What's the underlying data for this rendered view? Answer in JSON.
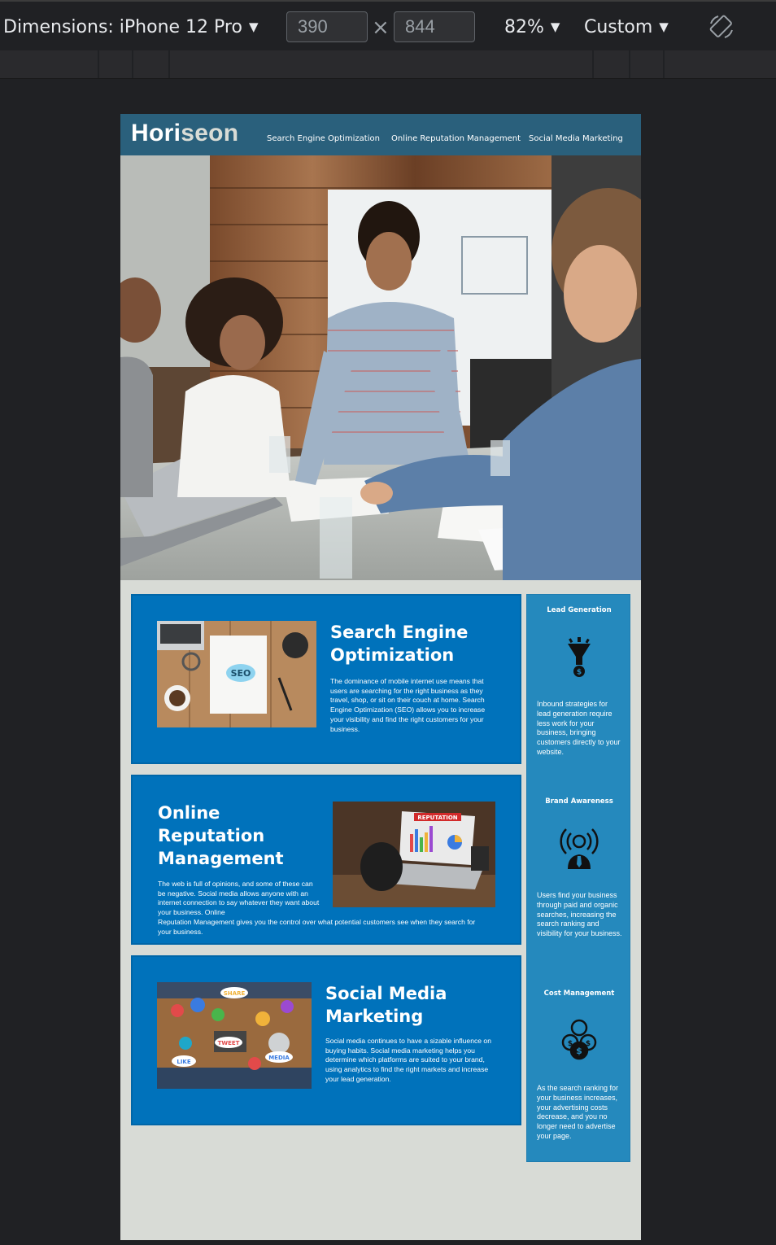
{
  "devtools": {
    "device_label": "Dimensions: iPhone 12 Pro",
    "width": "390",
    "height": "844",
    "times_symbol": "×",
    "zoom": "82%",
    "throttle": "Custom",
    "caret": "▼",
    "rotate_icon": "rotate-icon"
  },
  "site": {
    "logo_main": "Hori",
    "logo_accent": "seon",
    "nav": [
      {
        "label": "Search Engine Optimization"
      },
      {
        "label": "Online Reputation Management"
      },
      {
        "label": "Social Media Marketing"
      }
    ],
    "hero_alt": "hero-image",
    "content": [
      {
        "title_line1": "Search Engine",
        "title_line2": "Optimization",
        "text": "The dominance of mobile internet use means that users are searching for the right business as they travel, shop, or sit on their couch at home. Search Engine Optimization (SEO) allows you to increase your visibility and find the right customers for your business.",
        "image_label": "SEO"
      },
      {
        "title_line1": "Online",
        "title_line2": "Reputation",
        "title_line3": "Management",
        "text": "The web is full of opinions, and some of these can be negative. Social media allows anyone with an internet connection to say whatever they want about your business. Online Reputation Management gives you the control over what potential customers see when they search for your business.",
        "image_label": "REPUTATION"
      },
      {
        "title_line1": "Social Media",
        "title_line2": "Marketing",
        "text": "Social media continues to have a sizable influence on buying habits. Social media marketing helps you determine which platforms are suited to your brand, using analytics to find the right markets and increase your lead generation.",
        "image_labels": [
          "SHARE",
          "TWEET",
          "LIKE",
          "MEDIA"
        ]
      }
    ],
    "benefits": [
      {
        "title": "Lead Generation",
        "icon": "lead-generation-icon",
        "text": "Inbound strategies for lead generation require less work for your business, bringing customers directly to your website."
      },
      {
        "title": "Brand Awareness",
        "icon": "brand-awareness-icon",
        "text": "Users find your business through paid and organic searches, increasing the search ranking and visibility for your business."
      },
      {
        "title": "Cost Management",
        "icon": "cost-management-icon",
        "text": "As the search ranking for your business increases, your advertising costs decrease, and you no longer need to advertise your page."
      }
    ],
    "colors": {
      "header": "#2a607c",
      "card": "#0072bb",
      "sidebar": "#2589bd",
      "page_bg": "#d8dbd6"
    }
  }
}
